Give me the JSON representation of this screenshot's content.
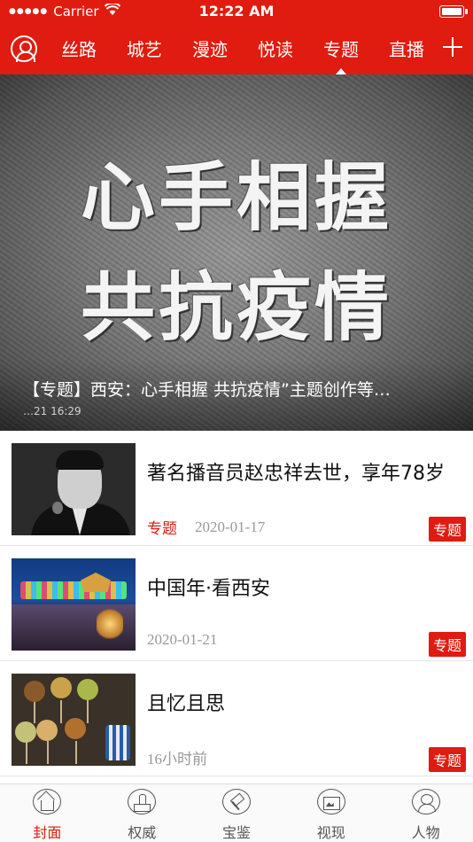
{
  "status_bar": {
    "carrier": "Carrier",
    "time": "12:22 AM"
  },
  "nav": {
    "tabs": [
      {
        "label": "丝路"
      },
      {
        "label": "城艺"
      },
      {
        "label": "漫迹"
      },
      {
        "label": "悦读"
      },
      {
        "label": "专题",
        "active": true
      },
      {
        "label": "直播"
      }
    ],
    "accent_color": "#e01b10"
  },
  "hero": {
    "art_line_1": "心手相握",
    "art_line_2": "共抗疫情",
    "caption": "【专题】西安：心手相握 共抗疫情”主题创作等…",
    "time": "…21 16:29"
  },
  "news": [
    {
      "title": "著名播音员赵忠祥去世，享年78岁",
      "tag": "专题",
      "date": "2020-01-17",
      "badge": "专题"
    },
    {
      "title": "中国年·看西安",
      "tag": "",
      "date": "2020-01-21",
      "badge": "专题"
    },
    {
      "title": "且忆且思",
      "tag": "",
      "date": "16小时前",
      "badge": "专题"
    }
  ],
  "tab_bar": [
    {
      "label": "封面",
      "icon": "home-icon",
      "active": true
    },
    {
      "label": "权威",
      "icon": "stamp-icon"
    },
    {
      "label": "宝鉴",
      "icon": "gavel-icon"
    },
    {
      "label": "视现",
      "icon": "photo-icon"
    },
    {
      "label": "人物",
      "icon": "person-icon"
    }
  ]
}
